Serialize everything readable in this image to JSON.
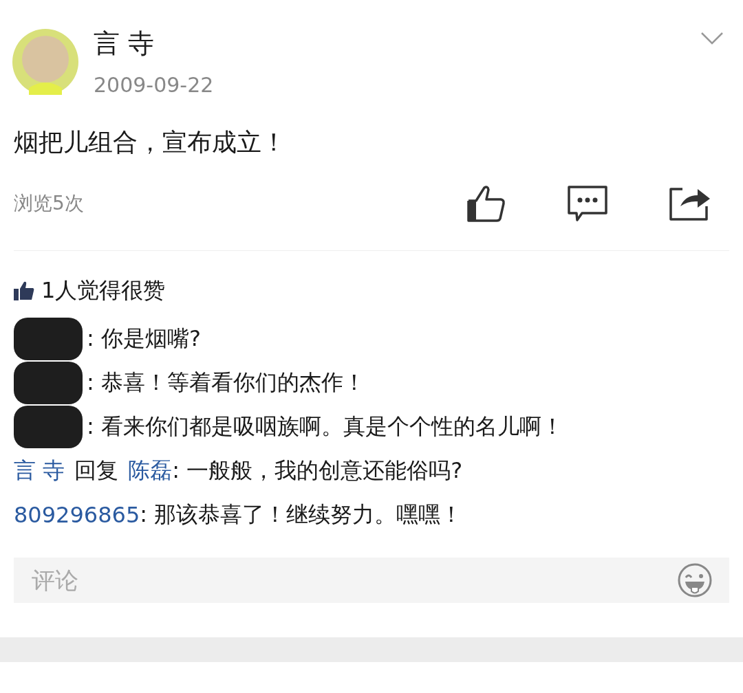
{
  "post": {
    "author": "言 寺",
    "date": "2009-09-22",
    "text": "烟把儿组合，宣布成立！",
    "views": "浏览5次"
  },
  "likes": {
    "text": "1人觉得很赞"
  },
  "comments": [
    {
      "redacted": true,
      "text": ": 你是烟嘴?"
    },
    {
      "redacted": true,
      "text": ": 恭喜！等着看你们的杰作！"
    },
    {
      "redacted": true,
      "text": ": 看来你们都是吸咽族啊。真是个个性的名儿啊！"
    },
    {
      "redacted": false,
      "author": "言 寺",
      "reply_word": "回复",
      "reply_to": "陈磊",
      "text": ": 一般般，我的创意还能俗吗?"
    },
    {
      "redacted": false,
      "author": "809296865",
      "text": ": 那该恭喜了！继续努力。嘿嘿！"
    }
  ],
  "comment_field": {
    "placeholder": "评论"
  }
}
